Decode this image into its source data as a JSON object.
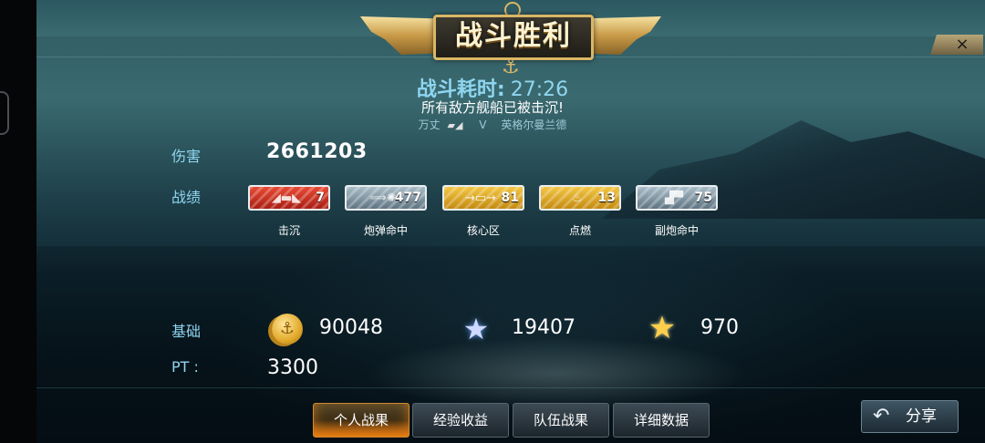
{
  "header": {
    "title": "战斗胜利",
    "close_icon": "×"
  },
  "battle": {
    "duration_label": "战斗耗时:",
    "duration_value": "27:26",
    "result_message": "所有敌方舰船已被击沉!",
    "player_ship": "万丈",
    "vs": "V",
    "enemy_ship": "英格尔曼兰德"
  },
  "damage": {
    "label": "伤害",
    "value": "2661203"
  },
  "achievements": {
    "label": "战绩",
    "items": [
      {
        "label": "击沉",
        "count": "7",
        "color": "red",
        "icon": "ship-sink-icon"
      },
      {
        "label": "炮弹命中",
        "count": "477",
        "color": "blue",
        "icon": "shell-hit-icon"
      },
      {
        "label": "核心区",
        "count": "81",
        "color": "gold",
        "icon": "citadel-icon"
      },
      {
        "label": "点燃",
        "count": "13",
        "color": "gold",
        "icon": "fire-icon"
      },
      {
        "label": "副炮命中",
        "count": "75",
        "color": "blue",
        "icon": "secondary-gun-icon"
      }
    ]
  },
  "base": {
    "label": "基础",
    "coins": "90048",
    "experience": "19407",
    "free_experience": "970"
  },
  "pt": {
    "label": "PT :",
    "value": "3300"
  },
  "tabs": [
    {
      "label": "个人战果",
      "active": true
    },
    {
      "label": "经验收益",
      "active": false
    },
    {
      "label": "队伍战果",
      "active": false
    },
    {
      "label": "详细数据",
      "active": false
    }
  ],
  "share": {
    "label": "分享",
    "icon": "back-arrow-icon"
  },
  "colors": {
    "accent_blue": "#8fd6f0",
    "gold": "#d9b766",
    "active_tab": "#c86a10"
  }
}
